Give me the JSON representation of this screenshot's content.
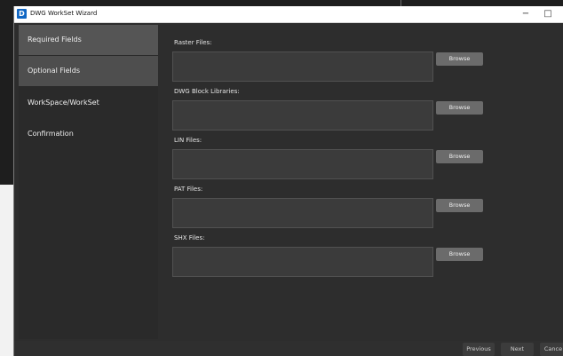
{
  "window": {
    "title": "DWG WorkSet Wizard",
    "app_icon_glyph": "D"
  },
  "window_controls": {
    "minimize": "−",
    "maximize": "□",
    "close": "✕"
  },
  "sidebar": {
    "items": [
      {
        "label": "Required Fields",
        "state": "active"
      },
      {
        "label": "Optional Fields",
        "state": "hover"
      },
      {
        "label": "WorkSpace/WorkSet",
        "state": "normal"
      },
      {
        "label": "Confirmation",
        "state": "normal"
      }
    ]
  },
  "fields": [
    {
      "label": "Raster Files:",
      "value": "",
      "button_label": "Browse"
    },
    {
      "label": "DWG Block Libraries:",
      "value": "",
      "button_label": "Browse"
    },
    {
      "label": "LIN Files:",
      "value": "",
      "button_label": "Browse"
    },
    {
      "label": "PAT Files:",
      "value": "",
      "button_label": "Browse"
    },
    {
      "label": "SHX Files:",
      "value": "",
      "button_label": "Browse"
    }
  ],
  "footer": {
    "previous_label": "Previous",
    "next_label": "Next",
    "cancel_label": "Cance"
  },
  "colors": {
    "window_bg": "#2d2d2d",
    "sidebar_active": "#555555",
    "sidebar_hover": "#4e4e4e",
    "field_bg": "#3b3b3b",
    "button_bg": "#6b6b6b",
    "accent_icon": "#1167c4"
  }
}
